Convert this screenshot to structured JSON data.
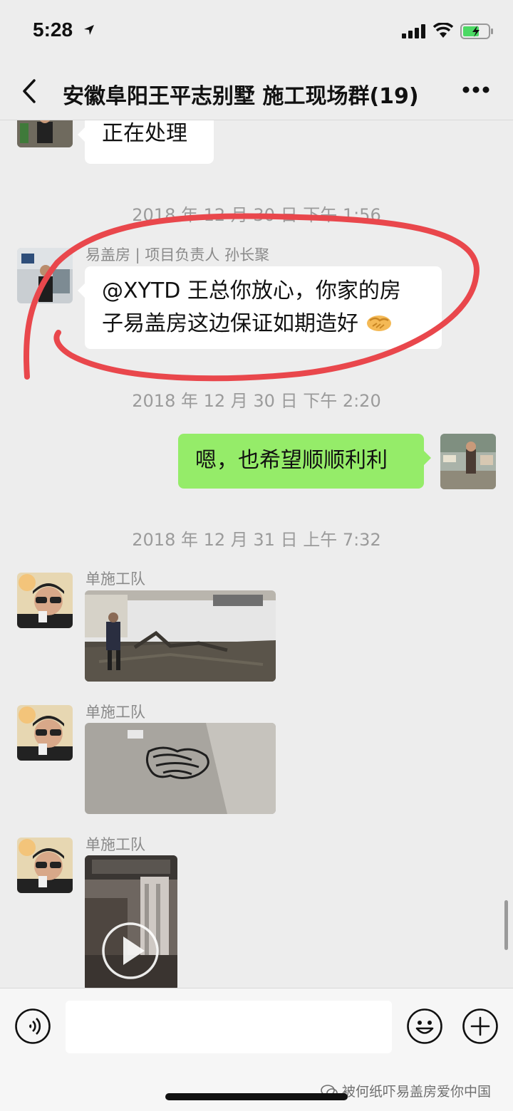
{
  "status_bar": {
    "time": "5:28"
  },
  "nav": {
    "title": "安徽阜阳王平志别墅 施工现场群(19)"
  },
  "messages": {
    "m1_text": "正在处理",
    "ts1": "2018 年 12 月 30 日 下午 1:56",
    "m2_sender": "易盖房 | 项目负责人 孙长聚",
    "m2_line1": "@XYTD 王总你放心，你家的房",
    "m2_line2": "子易盖房这边保证如期造好",
    "ts2": "2018 年 12 月 30 日 下午 2:20",
    "m3_text": "嗯，也希望顺顺利利",
    "ts3": "2018 年 12 月 31 日 上午 7:32",
    "m4_sender": "单施工队",
    "m5_sender": "单施工队",
    "m6_sender": "单施工队"
  },
  "input": {
    "placeholder": ""
  },
  "watermark": "被何纸吓易盖房爱你中国",
  "colors": {
    "background": "#ededed",
    "outgoing_bubble": "#95ec69",
    "incoming_bubble": "#ffffff",
    "annotation_circle": "#e9474c"
  },
  "icons": {
    "back": "chevron-left-icon",
    "more": "more-dots-icon",
    "voice": "voice-icon",
    "emoji": "emoji-icon",
    "plus": "plus-icon"
  }
}
